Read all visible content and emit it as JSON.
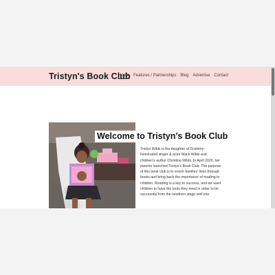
{
  "header": {
    "site_title": "Tristyn's Book Club",
    "nav": [
      {
        "label": "Home",
        "active": true
      },
      {
        "label": "Features / Partnerships",
        "active": false
      },
      {
        "label": "Blog",
        "active": false
      },
      {
        "label": "Advertise",
        "active": false
      },
      {
        "label": "Contact",
        "active": false
      }
    ]
  },
  "main": {
    "heading": "Welcome to Tristyn’s Book Club",
    "bio": "Tristyn Wilds is the daughter of Grammy-Nominated singer & actor Mack Wilds and children's author Christina Wilds. In April 2020, her parents launched Tristyn's Book Club. The purpose of this book club is to enrich families' lives through books and bring back the importance of reading to children. Reading is a key to success, and we want children to have the tools they need in order to be successful from the newborn stage well into"
  },
  "colors": {
    "header_bg": "#f9dcdc",
    "page_bg": "#ffffff",
    "outer_bg": "#f3f3f3"
  }
}
